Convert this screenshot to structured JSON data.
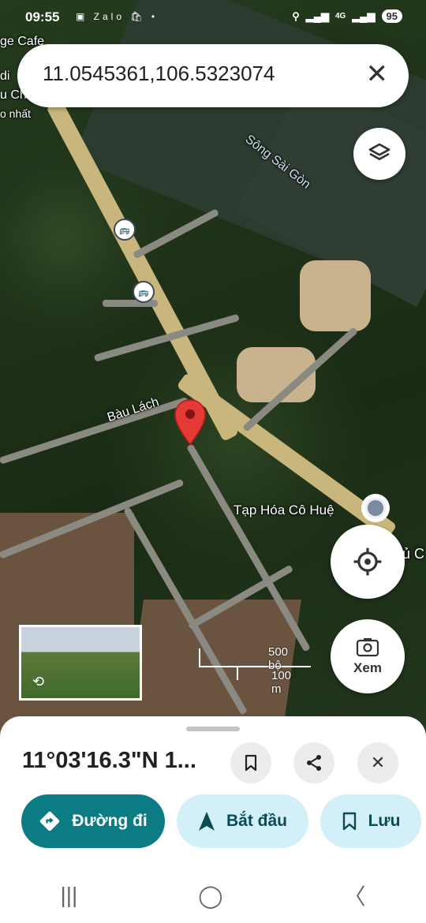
{
  "status_bar": {
    "time": "09:55",
    "app_icons": "▣ Zalo 🛍 •",
    "signal": "4G",
    "battery": "95"
  },
  "search": {
    "query": "11.0545361,106.5323074"
  },
  "map": {
    "labels": {
      "top_left_1": "ge Cafe",
      "top_left_2": "di",
      "top_left_3": "u Ch",
      "top_left_4": "o nhất",
      "river": "Sông Sài Gòn",
      "road": "Bàu Lách",
      "poi": "Tạp Hóa Cô Huệ",
      "edge": "ủ C"
    },
    "scale": {
      "imperial": "500 bộ",
      "metric": "100 m"
    },
    "explore_label": "Xem"
  },
  "sheet": {
    "coordinates": "11°03'16.3\"N 1...",
    "directions_label": "Đường đi",
    "start_label": "Bắt đầu",
    "save_label": "Lưu",
    "colors": {
      "primary": "#0b7b84",
      "tonal": "#d3f0f8"
    }
  }
}
